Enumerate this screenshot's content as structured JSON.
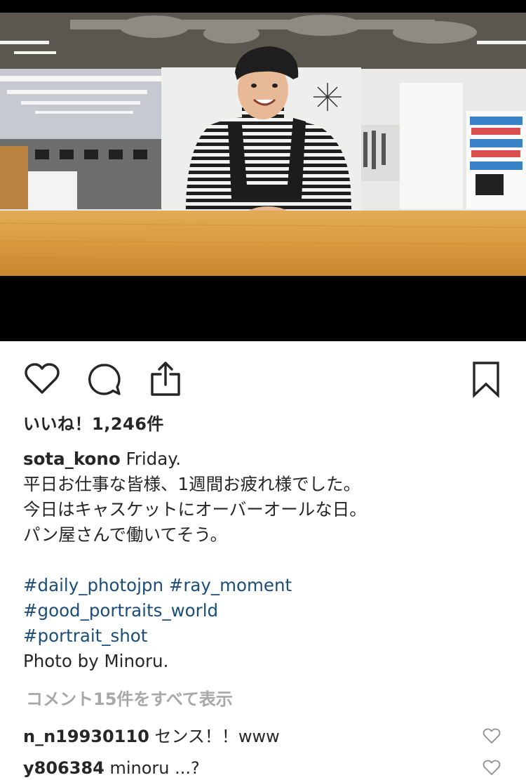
{
  "post": {
    "likes_label": "いいね！1,246件",
    "caption": {
      "username": "sota_kono",
      "lines": [
        "Friday.",
        "平日お仕事な皆様、1週間お疲れ様でした。",
        "今日はキャスケットにオーバーオールな日。",
        "パン屋さんで働いてそう。"
      ],
      "hashtags": [
        "#daily_photojpn #ray_moment",
        "#good_portraits_world",
        "#portrait_shot"
      ],
      "credit": "Photo by Minoru."
    },
    "view_all_comments": "コメント15件をすべて表示",
    "comments": [
      {
        "username": "n_n19930110",
        "text": "センス！！www"
      },
      {
        "username": "y806384",
        "text": "minoru ...?"
      }
    ]
  },
  "icons": {
    "like": "heart-icon",
    "comment": "comment-bubble-icon",
    "share": "share-icon",
    "save": "bookmark-icon"
  }
}
